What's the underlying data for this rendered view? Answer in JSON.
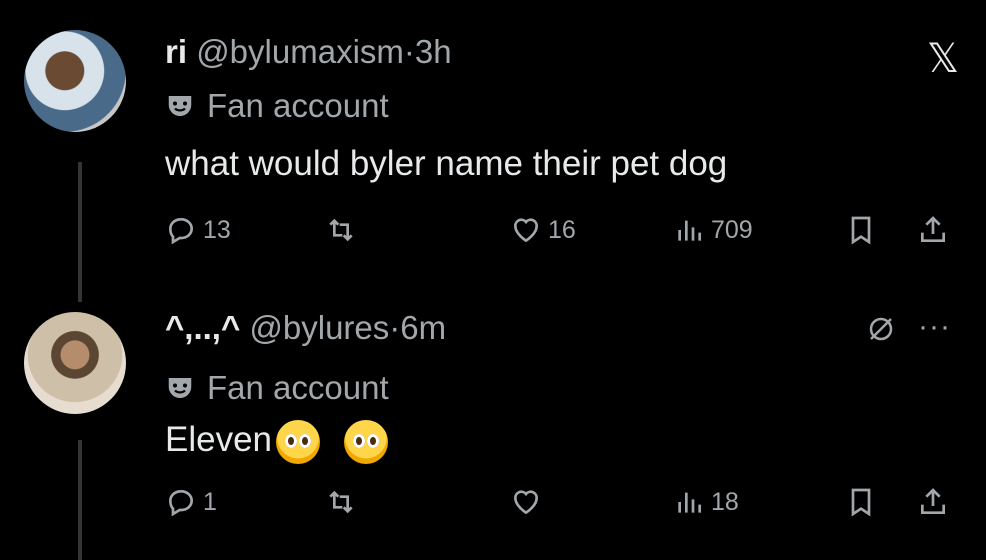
{
  "tweets": [
    {
      "display_name": "ri",
      "handle": "@bylumaxism",
      "separator": "·",
      "time": "3h",
      "label": "Fan account",
      "text": "what would byler name their pet dog",
      "replies": "13",
      "reposts": "",
      "likes": "16",
      "views": "709"
    },
    {
      "display_name": "^,..,^",
      "handle": "@bylures",
      "separator": "·",
      "time": "6m",
      "label": "Fan account",
      "text": "Eleven",
      "replies": "1",
      "reposts": "",
      "likes": "",
      "views": "18"
    }
  ],
  "icons": {
    "brand": "x-logo",
    "label_icon": "theater-mask-icon",
    "reply": "reply-icon",
    "repost": "repost-icon",
    "like": "heart-icon",
    "views": "views-icon",
    "bookmark": "bookmark-icon",
    "share": "share-icon",
    "hide": "hide-icon",
    "more": "more-icon"
  },
  "emoji": [
    "pleading-face",
    "pleading-face"
  ]
}
